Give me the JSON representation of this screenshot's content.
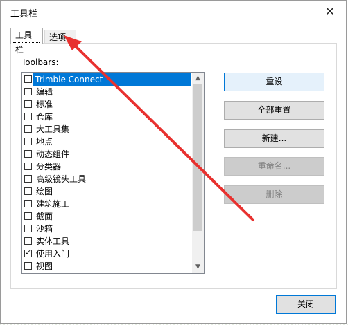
{
  "window": {
    "title": "工具栏",
    "close_glyph": "✕"
  },
  "tabs": [
    {
      "label": "工具栏",
      "active": true
    },
    {
      "label": "选项",
      "active": false
    }
  ],
  "toolbars_label": {
    "mnemonic": "T",
    "rest": "oolbars:"
  },
  "list_items": [
    {
      "label": "Trimble Connect",
      "checked": false,
      "selected": true
    },
    {
      "label": "编辑",
      "checked": false
    },
    {
      "label": "标准",
      "checked": false
    },
    {
      "label": "仓库",
      "checked": false
    },
    {
      "label": "大工具集",
      "checked": false
    },
    {
      "label": "地点",
      "checked": false
    },
    {
      "label": "动态组件",
      "checked": false
    },
    {
      "label": "分类器",
      "checked": false
    },
    {
      "label": "高级镜头工具",
      "checked": false
    },
    {
      "label": "绘图",
      "checked": false
    },
    {
      "label": "建筑施工",
      "checked": false
    },
    {
      "label": "截面",
      "checked": false
    },
    {
      "label": "沙箱",
      "checked": false
    },
    {
      "label": "实体工具",
      "checked": false
    },
    {
      "label": "使用入门",
      "checked": true
    },
    {
      "label": "视图",
      "checked": false
    }
  ],
  "buttons": {
    "reset": "重设",
    "reset_all": "全部重置",
    "new": "新建...",
    "rename": "重命名...",
    "delete": "删除",
    "close": "关闭"
  },
  "scrollbar": {
    "up_glyph": "▲",
    "down_glyph": "▼"
  },
  "colors": {
    "selection": "#0078d7",
    "annotation_arrow": "#e8312f"
  }
}
